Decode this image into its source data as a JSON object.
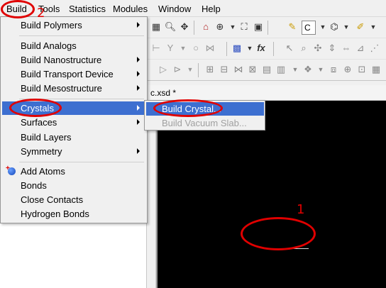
{
  "menubar": {
    "items": [
      "Build",
      "Tools",
      "Statistics",
      "Modules",
      "Window",
      "Help"
    ]
  },
  "document": {
    "tab_title": "c.xsd *"
  },
  "toolbar": {
    "combo_value": "C"
  },
  "build_menu": {
    "items": [
      {
        "label": "Build Polymers",
        "submenu": true
      },
      {
        "label": "Build Analogs",
        "submenu": false
      },
      {
        "label": "Build Nanostructure",
        "submenu": true
      },
      {
        "label": "Build Transport Device",
        "submenu": true
      },
      {
        "label": "Build Mesostructure",
        "submenu": true
      },
      {
        "label": "Crystals",
        "submenu": true,
        "highlighted": true
      },
      {
        "label": "Surfaces",
        "submenu": true
      },
      {
        "label": "Build Layers",
        "submenu": false
      },
      {
        "label": "Symmetry",
        "submenu": true
      },
      {
        "label": "Add Atoms",
        "submenu": false,
        "icon": "add-atom-icon"
      },
      {
        "label": "Bonds",
        "submenu": false
      },
      {
        "label": "Close Contacts",
        "submenu": false
      },
      {
        "label": "Hydrogen Bonds",
        "submenu": false
      }
    ]
  },
  "crystals_submenu": {
    "items": [
      {
        "label": "Build Crystal...",
        "highlighted": true,
        "enabled": true
      },
      {
        "label": "Build Vacuum Slab...",
        "highlighted": false,
        "enabled": false
      }
    ]
  },
  "annotations": {
    "label_1": "1",
    "label_2": "2",
    "color": "#e00000"
  },
  "colors": {
    "highlight": "#3d6fd0",
    "viewport_background": "#000000",
    "menu_background": "#f0f0f0"
  }
}
